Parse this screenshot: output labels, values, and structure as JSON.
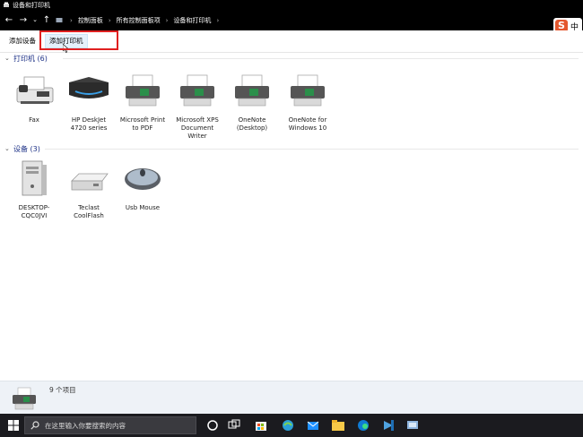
{
  "window": {
    "title": "设备和打印机"
  },
  "address": {
    "crumbs": [
      "控制面板",
      "所有控制面板项",
      "设备和打印机"
    ]
  },
  "ime": {
    "logo": "S",
    "lang": "中"
  },
  "toolbar": {
    "add_device": "添加设备",
    "add_printer": "添加打印机"
  },
  "printers": {
    "header": "打印机 (6)",
    "items": [
      {
        "label": "Fax",
        "icon": "fax-icon"
      },
      {
        "label": "HP DeskJet 4720 series",
        "icon": "inkjet-printer-icon"
      },
      {
        "label": "Microsoft Print to PDF",
        "icon": "printer-icon"
      },
      {
        "label": "Microsoft XPS Document Writer",
        "icon": "printer-icon"
      },
      {
        "label": "OneNote (Desktop)",
        "icon": "printer-icon"
      },
      {
        "label": "OneNote for Windows 10",
        "icon": "printer-icon"
      }
    ]
  },
  "devices": {
    "header": "设备 (3)",
    "items": [
      {
        "label": "DESKTOP-CQC0JVI",
        "icon": "computer-tower-icon"
      },
      {
        "label": "Teclast CoolFlash",
        "icon": "usb-drive-icon"
      },
      {
        "label": "Usb Mouse",
        "icon": "mouse-icon"
      }
    ]
  },
  "status": {
    "count": "9 个项目"
  },
  "taskbar": {
    "search_placeholder": "在这里输入你要搜索的内容",
    "apps": [
      "cortana-icon",
      "task-view-icon",
      "store-icon",
      "edge-icon",
      "mail-icon",
      "file-explorer-icon",
      "edge-browser-icon",
      "vscode-icon",
      "control-panel-icon"
    ]
  },
  "colors": {
    "accent": "#1e3287",
    "highlight": "#e02020",
    "taskbar": "#1b1b1f"
  }
}
